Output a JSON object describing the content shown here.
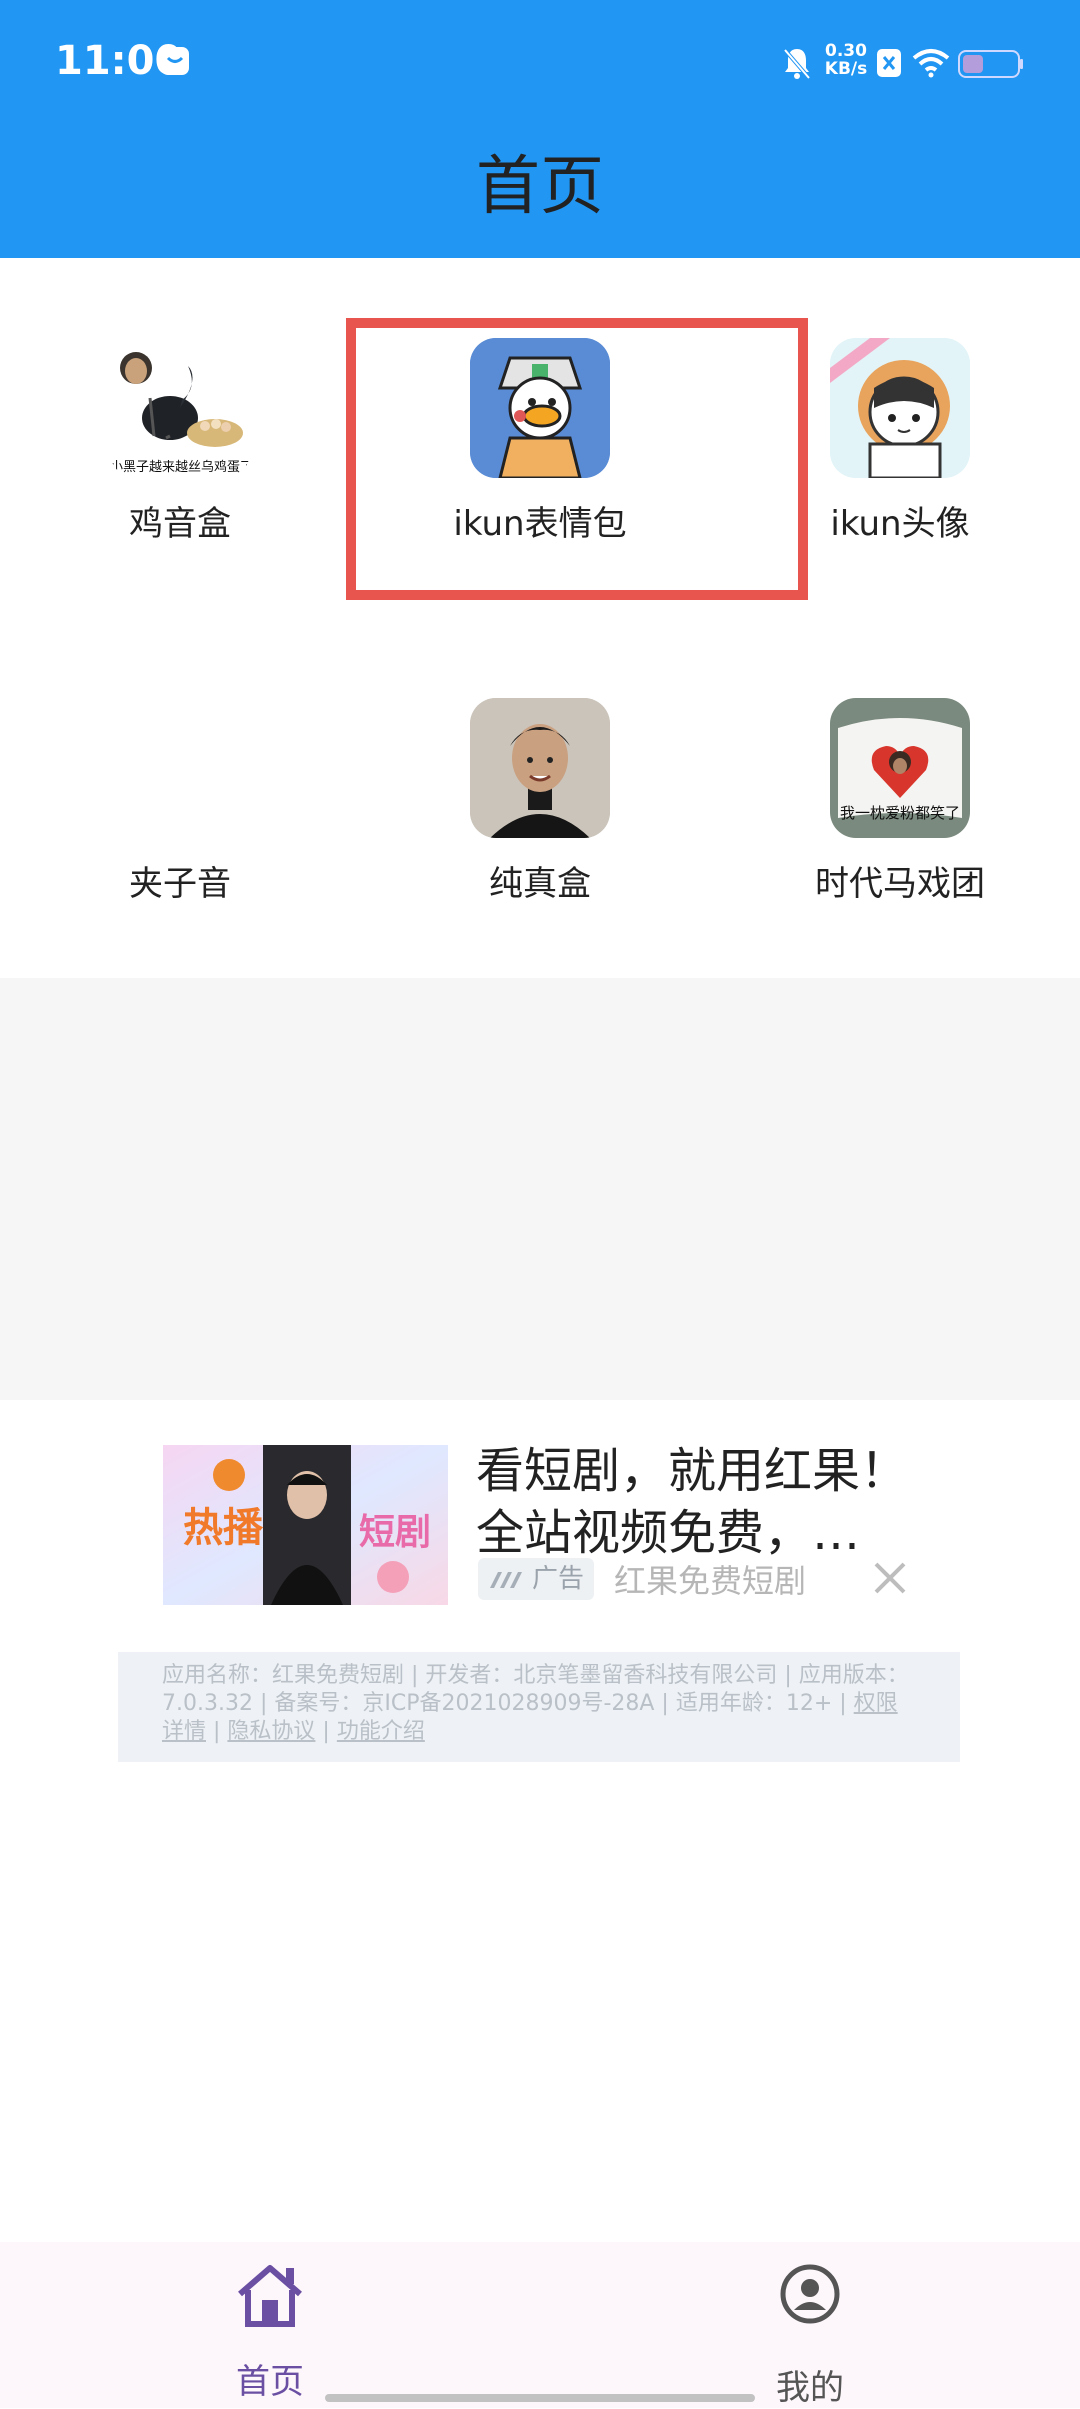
{
  "status_bar": {
    "time": "11:00",
    "net_speed_value": "0.30",
    "net_speed_unit": "KB/s",
    "icons": [
      "message-icon",
      "mute-bell-icon",
      "no-sim-icon",
      "wifi-icon",
      "battery-icon"
    ]
  },
  "header": {
    "title": "首页"
  },
  "grid": {
    "items": [
      {
        "label": "鸡音盒",
        "caption": "小黑子越来越丝乌鸡蛋了"
      },
      {
        "label": "ikun表情包",
        "caption": ""
      },
      {
        "label": "ikun头像",
        "caption": ""
      },
      {
        "label": "夹子音",
        "caption": ""
      },
      {
        "label": "纯真盒",
        "caption": ""
      },
      {
        "label": "时代马戏团",
        "caption": "我一枕爱粉都笑了"
      }
    ],
    "highlight_color": "#e8544e"
  },
  "ad": {
    "headline": "看短剧，就用红果！全站视频免费，…",
    "badge": "广告",
    "brand": "红果免费短剧",
    "image_text_left": "热播",
    "image_text_right": "短剧",
    "info_text": "应用名称：红果免费短剧 | 开发者：北京笔墨留香科技有限公司 | 应用版本：7.0.3.32 | 备案号：京ICP备2021028909号-28A | 适用年龄：12+ | ",
    "info_links": [
      "权限详情",
      "隐私协议",
      "功能介绍"
    ]
  },
  "bottom_nav": {
    "items": [
      {
        "label": "首页",
        "icon": "home-icon",
        "active": true
      },
      {
        "label": "我的",
        "icon": "profile-icon",
        "active": false
      }
    ],
    "active_color": "#6a4fa3",
    "inactive_color": "#555555"
  },
  "colors": {
    "header_bg": "#2196f3",
    "accent": "#6a4fa3"
  }
}
